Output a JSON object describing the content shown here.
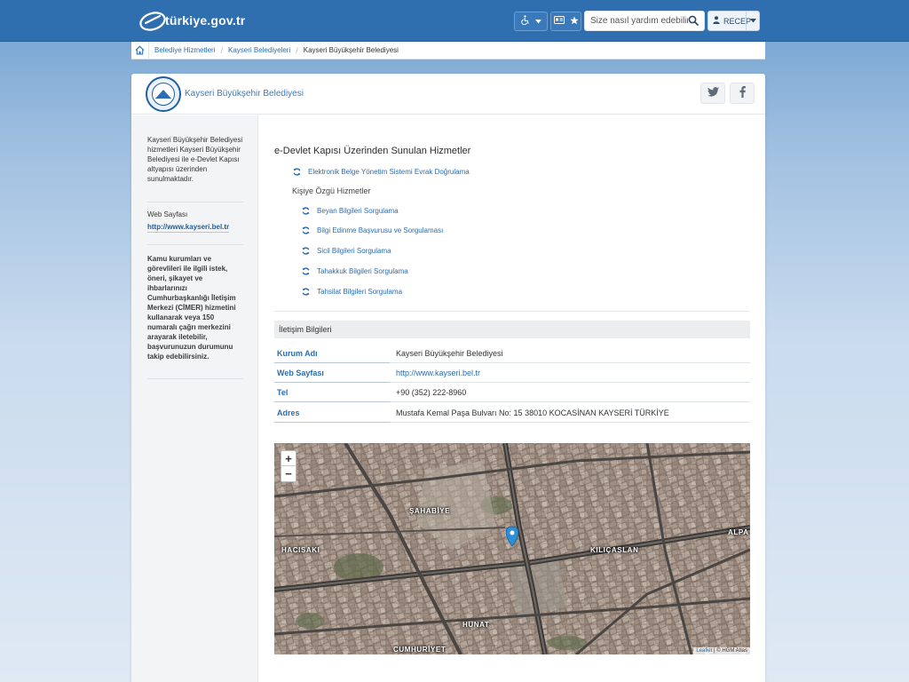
{
  "header": {
    "logo_text": "türkiye.gov.tr",
    "search_placeholder": "Size nasıl yardım edebilirim?",
    "user_name": "RECEP",
    "accent_color": "#2f6fb0"
  },
  "breadcrumb": {
    "items": [
      "Belediye Hizmetleri",
      "Kayseri Belediyeleri"
    ],
    "current": "Kayseri Büyükşehir Belediyesi"
  },
  "org": {
    "title": "Kayseri Büyükşehir Belediyesi"
  },
  "sidebar": {
    "description": "Kayseri Büyükşehir Belediyesi hizmetleri Kayseri Büyükşehir Belediyesi ile e-Devlet Kapısı altyapısı üzerinden sunulmaktadır.",
    "web_label": "Web Sayfası",
    "web_url": "http://www.kayseri.bel.tr",
    "cimer_text": "Kamu kurumları ve görevlileri ile ilgili istek, öneri, şikayet ve ihbarlarınızı Cumhurbaşkanlığı İletişim Merkezi (CİMER) hizmetini kullanarak veya 150 numaralı çağrı merkezini arayarak iletebilir, başvurunuzun durumunu takip edebilirsiniz."
  },
  "services": {
    "title": "e-Devlet Kapısı Üzerinden Sunulan Hizmetler",
    "top_link": "Elektronik Belge Yönetim Sistemi Evrak Doğrulama",
    "personal_title": "Kişiye Özgü Hizmetler",
    "personal_links": [
      "Beyan Bilgileri Sorgulama",
      "Bilgi Edinme Başvurusu ve Sorgulaması",
      "Sicil Bilgileri Sorgulama",
      "Tahakkuk Bilgileri Sorgulama",
      "Tahsilat Bilgileri Sorgulama"
    ]
  },
  "contact": {
    "title": "İletişim Bilgileri",
    "rows": [
      {
        "label": "Kurum Adı",
        "value": "Kayseri Büyükşehir Belediyesi"
      },
      {
        "label": "Web Sayfası",
        "value": "http://www.kayseri.bel.tr"
      },
      {
        "label": "Tel",
        "value": "+90 (352) 222-8960"
      },
      {
        "label": "Adres",
        "value": "Mustafa Kemal Paşa Bulvarı No: 15 38010 KOCASİNAN KAYSERİ TÜRKİYE"
      }
    ]
  },
  "map": {
    "zoom_in": "+",
    "zoom_out": "−",
    "districts": [
      "ŞAHABİYE",
      "HACISAKI",
      "KILIÇASLAN",
      "ALPA",
      "HUNAT",
      "CUMHURİYET"
    ],
    "attribution_link": "Leaflet",
    "attribution_text": " | © HGM Atlas"
  }
}
